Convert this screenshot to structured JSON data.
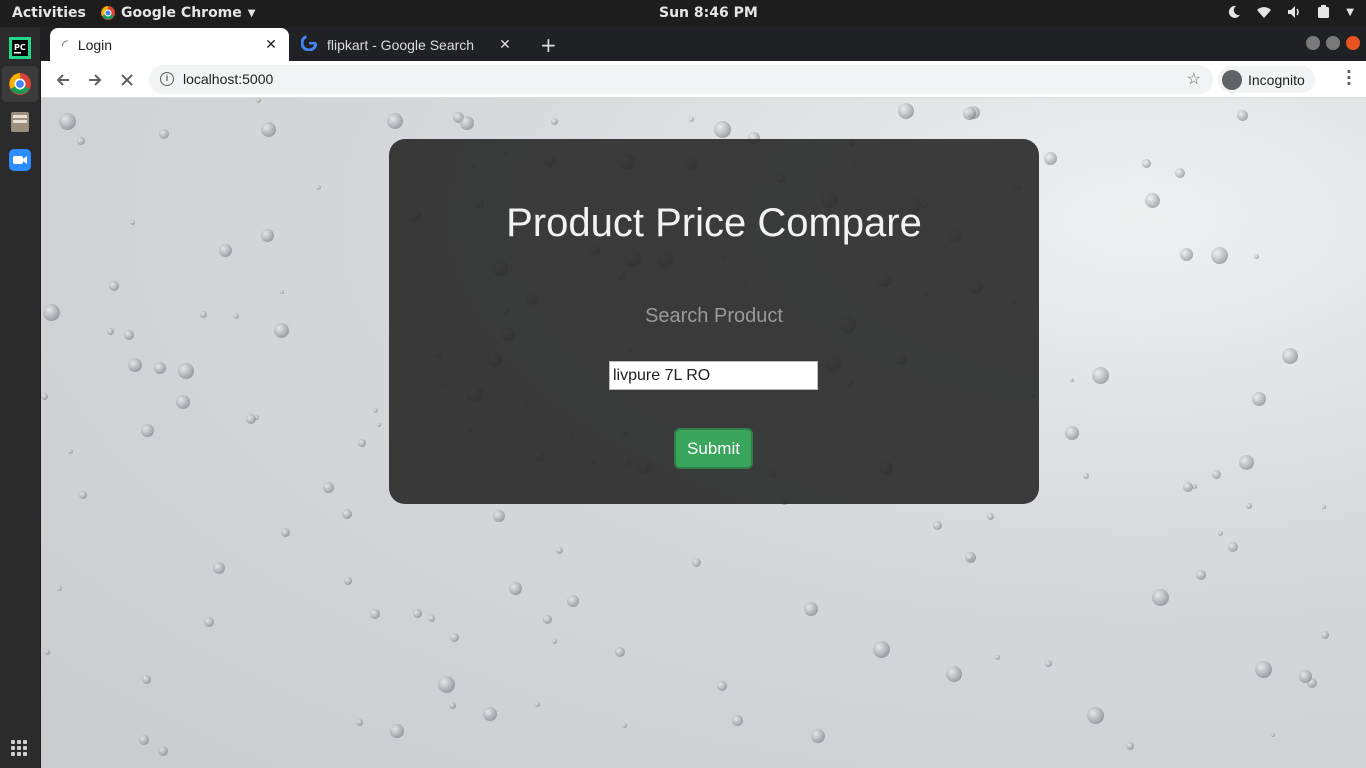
{
  "system": {
    "activities": "Activities",
    "app_name": "Google Chrome",
    "clock": "Sun  8:46 PM"
  },
  "browser": {
    "tabs": [
      {
        "title": "Login",
        "active": true
      },
      {
        "title": "flipkart - Google Search",
        "active": false
      }
    ],
    "url": "localhost:5000",
    "incognito_label": "Incognito"
  },
  "page": {
    "title": "Product Price Compare",
    "search_label": "Search Product",
    "search_value": "livpure 7L RO",
    "submit_label": "Submit"
  },
  "colors": {
    "card_bg": "#282828",
    "submit_bg": "#3aa55c",
    "ubuntu_orange": "#e95420"
  }
}
